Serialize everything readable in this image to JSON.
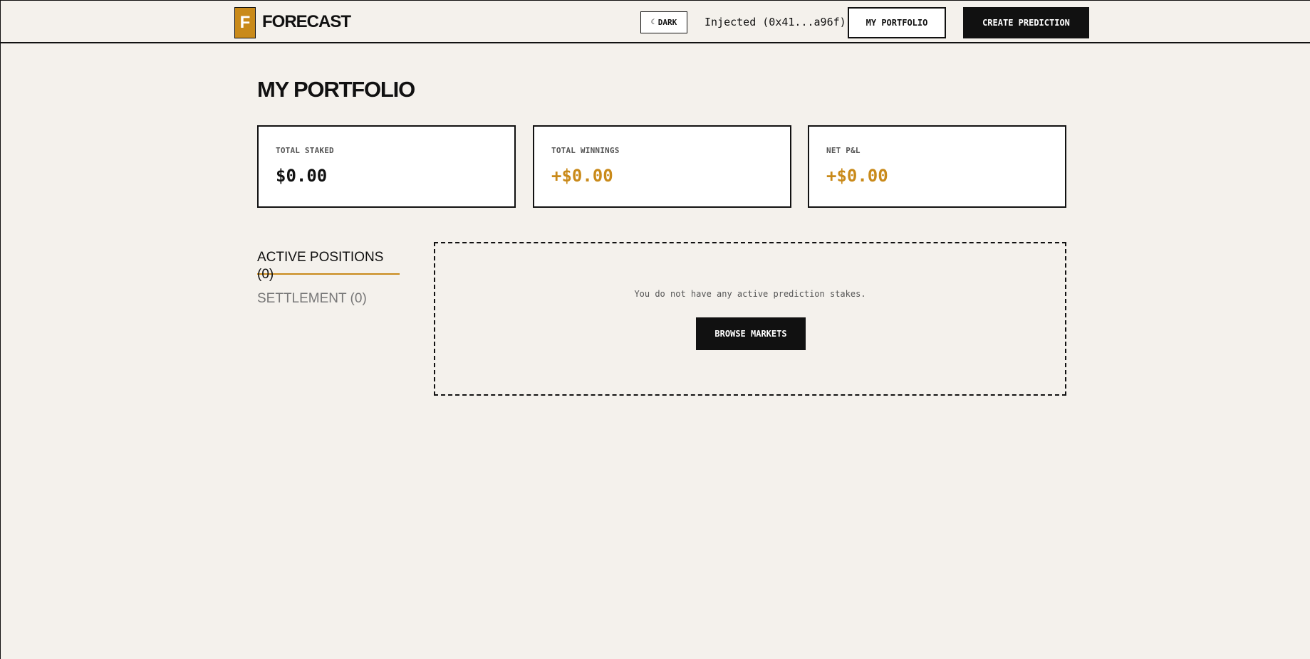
{
  "header": {
    "logo_letter": "F",
    "logo_text": "FORECAST",
    "theme_toggle": {
      "icon": "moon-icon",
      "glyph": "☾",
      "label": "DARK"
    },
    "wallet": "Injected (0x41...a96f)",
    "portfolio_label": "MY PORTFOLIO",
    "create_label": "CREATE PREDICTION"
  },
  "main": {
    "title": "MY PORTFOLIO",
    "stats": [
      {
        "label": "TOTAL STAKED",
        "value": "$0.00"
      },
      {
        "label": "TOTAL WINNINGS",
        "value": "+$0.00"
      },
      {
        "label": "NET P&L",
        "value": "+$0.00"
      }
    ],
    "tabs": [
      {
        "label": "ACTIVE POSITIONS (0)",
        "active": true
      },
      {
        "label": "SETTLEMENT (0)",
        "active": false
      }
    ],
    "empty": {
      "message": "You do not have any active prediction stakes.",
      "button": "BROWSE MARKETS"
    }
  },
  "colors": {
    "background": "#f4f1ec",
    "accent": "#c98a1a",
    "ink": "#111111"
  }
}
